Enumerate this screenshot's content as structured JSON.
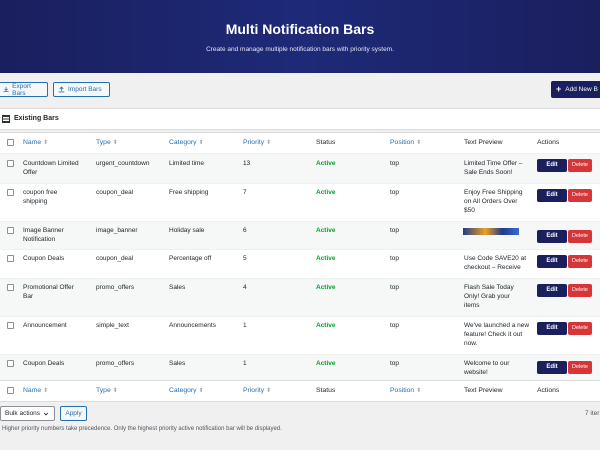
{
  "header": {
    "title": "Multi Notification Bars",
    "subtitle": "Create and manage multiple notification bars with priority system."
  },
  "toolbar": {
    "export_label": "Export Bars",
    "import_label": "Import Bars",
    "add_label": "Add New B"
  },
  "panel": {
    "title": "Existing Bars"
  },
  "table": {
    "columns": [
      "Name",
      "Type",
      "Category",
      "Priority",
      "Status",
      "Position",
      "Text Preview",
      "Actions"
    ],
    "rows": [
      {
        "name": "Countdown Limited Offer",
        "type": "urgent_countdown",
        "category": "Limited time",
        "priority": "13",
        "status": "Active",
        "position": "top",
        "preview": "Limited Time Offer – Sale Ends Soon!"
      },
      {
        "name": "coupon free shipping",
        "type": "coupon_deal",
        "category": "Free shipping",
        "priority": "7",
        "status": "Active",
        "position": "top",
        "preview": "Enjoy Free Shipping on All Orders Over $50"
      },
      {
        "name": "Image Banner Notification",
        "type": "image_banner",
        "category": "Holiday sale",
        "priority": "6",
        "status": "Active",
        "position": "top",
        "preview": ""
      },
      {
        "name": "Coupon Deals",
        "type": "coupon_deal",
        "category": "Percentage off",
        "priority": "5",
        "status": "Active",
        "position": "top",
        "preview": "Use Code SAVE20 at checkout – Receive"
      },
      {
        "name": "Promotional Offer Bar",
        "type": "promo_offers",
        "category": "Sales",
        "priority": "4",
        "status": "Active",
        "position": "top",
        "preview": "Flash Sale Today Only! Grab your items"
      },
      {
        "name": "Announcement",
        "type": "simple_text",
        "category": "Announcements",
        "priority": "1",
        "status": "Active",
        "position": "top",
        "preview": "We've launched a new feature! Check it out now."
      },
      {
        "name": "Coupon Deals",
        "type": "promo_offers",
        "category": "Sales",
        "priority": "1",
        "status": "Active",
        "position": "top",
        "preview": "Welcome to our website!"
      }
    ],
    "edit_label": "Edit",
    "delete_label": "Delete"
  },
  "footer": {
    "bulk_label": "Bulk actions",
    "apply_label": "Apply",
    "items_count": "7 iter",
    "note": "Higher priority numbers take precedence. Only the highest priority active notification bar will be displayed."
  }
}
